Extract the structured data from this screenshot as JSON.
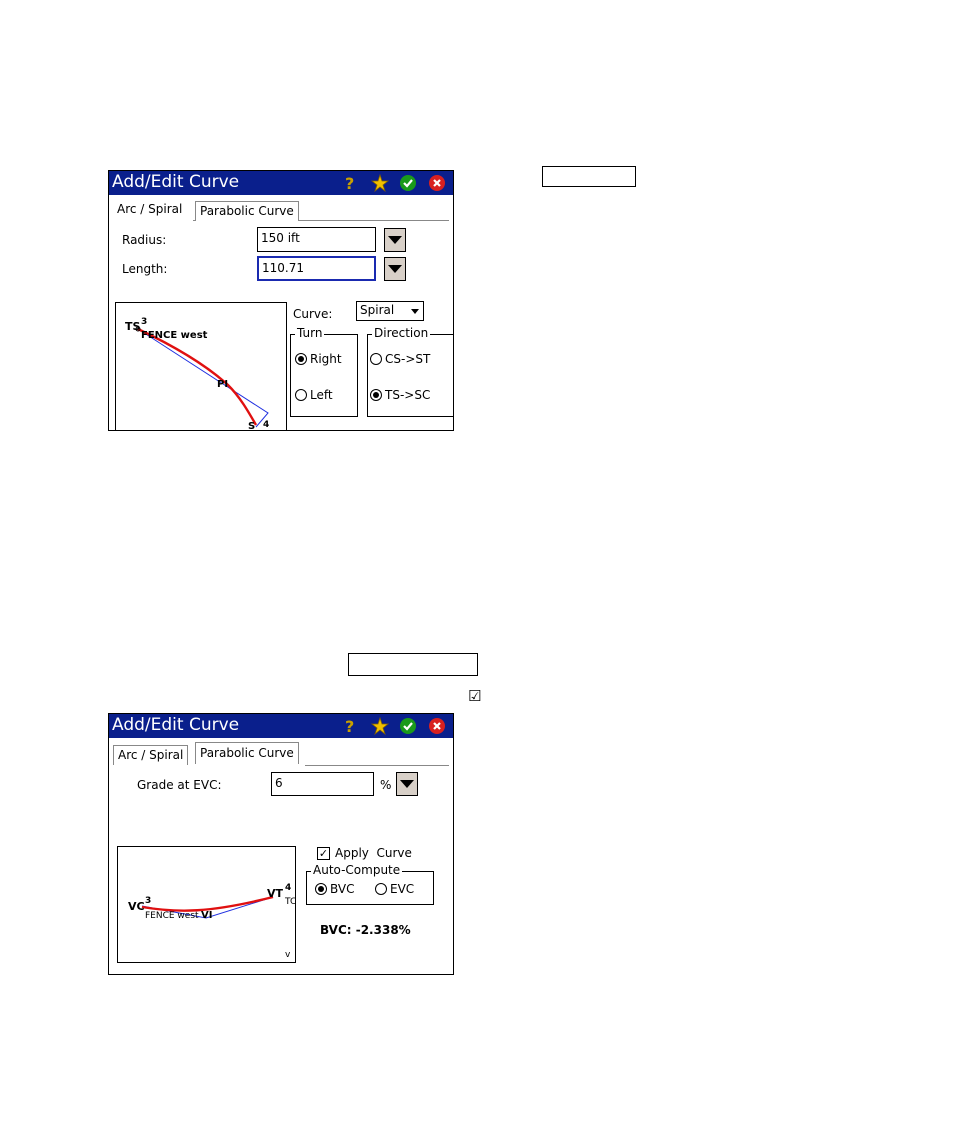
{
  "dialog1": {
    "title": "Add/Edit Curve",
    "tabs": [
      "Arc / Spiral",
      "Parabolic Curve"
    ],
    "active_tab": "Arc / Spiral",
    "radius_label": "Radius:",
    "radius_value": "150 ift",
    "length_label": "Length:",
    "length_value": "110.71",
    "curve_label": "Curve:",
    "curve_value": "Spiral",
    "turn_group": "Turn",
    "turn_right": "Right",
    "turn_left": "Left",
    "direction_group": "Direction",
    "dir_cs_st": "CS->ST",
    "dir_ts_sc": "TS->SC",
    "plot_labels": {
      "ts": "TS",
      "ts_num": "3",
      "fence": "FENCE west",
      "pi": "PI",
      "end_num": "4",
      "end_prefix": "S"
    }
  },
  "dialog2": {
    "title": "Add/Edit Curve",
    "tabs": [
      "Arc / Spiral",
      "Parabolic Curve"
    ],
    "active_tab": "Parabolic Curve",
    "grade_label": "Grade at EVC:",
    "grade_value": "6",
    "grade_unit": "%",
    "apply_curve": "Apply  Curve",
    "auto_compute_group": "Auto-Compute",
    "opt_bvc": "BVC",
    "opt_evc": "EVC",
    "result": "BVC: -2.338%",
    "plot_labels": {
      "vc": "VC",
      "vc_num": "3",
      "fence": "FENCE west",
      "vi": "VI",
      "vt": "VT",
      "vt_num": "4",
      "tc": "TC",
      "v": "v"
    }
  },
  "checkbox_glyph": "☑",
  "colors": {
    "titlebar": "#0a1f8c",
    "curve_red": "#e01010",
    "line_blue": "#2030e0",
    "help_icon": "#c8a000",
    "star_icon": "#f0c000",
    "ok_icon": "#1a9a1a",
    "close_icon": "#d82020",
    "dropdown_btn": "#d8d0c8"
  }
}
